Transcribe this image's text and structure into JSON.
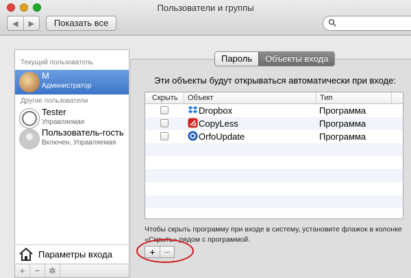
{
  "window": {
    "title": "Пользователи и группы",
    "show_all": "Показать все",
    "back": "◀",
    "forward": "▶"
  },
  "sidebar": {
    "current_header": "Текущий пользователь",
    "other_header": "Другие пользователи",
    "current_user": {
      "name": "M",
      "role": "Администратор"
    },
    "other_users": [
      {
        "name": "Tester",
        "role": "Управляемая"
      },
      {
        "name": "Пользователь-гость",
        "role": "Включен, Управляемая"
      }
    ],
    "login_options": "Параметры входа",
    "toolbar": {
      "add": "+",
      "remove": "−",
      "settings": "✲"
    }
  },
  "tabs": {
    "password": "Пароль",
    "login_items": "Объекты входа"
  },
  "main": {
    "heading": "Эти объекты будут открываться автоматически при входе:",
    "columns": {
      "hide": "Скрыть",
      "item": "Объект",
      "type": "Тип"
    },
    "items": [
      {
        "name": "Dropbox",
        "type": "Программа",
        "hidden": false,
        "icon": "dropbox-icon"
      },
      {
        "name": "CopyLess",
        "type": "Программа",
        "hidden": false,
        "icon": "copyless-icon"
      },
      {
        "name": "OrfoUpdate",
        "type": "Программа",
        "hidden": false,
        "icon": "orfoupdate-icon"
      }
    ],
    "note": "Чтобы скрыть программу при входе в систему, установите флажок в колонке «Скрыть» рядом с программой.",
    "add_label": "+",
    "remove_label": "−"
  },
  "colors": {
    "selection": "#3d74c9",
    "highlight_ring": "#d31515"
  }
}
